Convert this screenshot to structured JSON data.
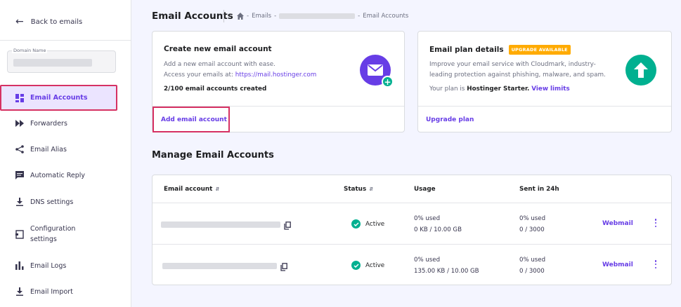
{
  "sidebar": {
    "back_label": "Back to emails",
    "domain_label": "Domain Name",
    "items": [
      {
        "label": "Email Accounts",
        "icon": "grid-icon"
      },
      {
        "label": "Forwarders",
        "icon": "fast-forward-icon"
      },
      {
        "label": "Email Alias",
        "icon": "share-icon"
      },
      {
        "label": "Automatic Reply",
        "icon": "message-icon"
      },
      {
        "label": "DNS settings",
        "icon": "download-icon"
      },
      {
        "label": "Configuration settings",
        "icon": "config-icon"
      },
      {
        "label": "Email Logs",
        "icon": "bar-chart-icon"
      },
      {
        "label": "Email Import",
        "icon": "import-icon"
      }
    ]
  },
  "header": {
    "title": "Email Accounts",
    "breadcrumb": [
      "Emails",
      "Email Accounts"
    ]
  },
  "create_card": {
    "title": "Create new email account",
    "line1": "Add a new email account with ease.",
    "line2_prefix": "Access your emails at: ",
    "link": "https://mail.hostinger.com",
    "count": "2/100 email accounts created",
    "action": "Add email account"
  },
  "plan_card": {
    "title": "Email plan details",
    "badge": "UPGRADE AVAILABLE",
    "line1": "Improve your email service with Cloudmark, industry-",
    "line2": "leading protection against phishing, malware, and spam.",
    "plan_prefix": "Your plan is ",
    "plan_name": "Hostinger Starter.",
    "view_limits": "View limits",
    "action": "Upgrade plan"
  },
  "manage": {
    "title": "Manage Email Accounts",
    "columns": {
      "email": "Email account",
      "status": "Status",
      "usage": "Usage",
      "sent": "Sent in 24h"
    },
    "rows": [
      {
        "status": "Active",
        "usage_pct": "0% used",
        "usage_detail": "0 KB / 10.00 GB",
        "sent_pct": "0% used",
        "sent_detail": "0 / 3000",
        "action": "Webmail"
      },
      {
        "status": "Active",
        "usage_pct": "0% used",
        "usage_detail": "135.00 KB / 10.00 GB",
        "sent_pct": "0% used",
        "sent_detail": "0 / 3000",
        "action": "Webmail"
      }
    ]
  },
  "colors": {
    "accent": "#673de6",
    "success": "#00b090",
    "highlight": "#d63163",
    "badge": "#ffab00"
  }
}
